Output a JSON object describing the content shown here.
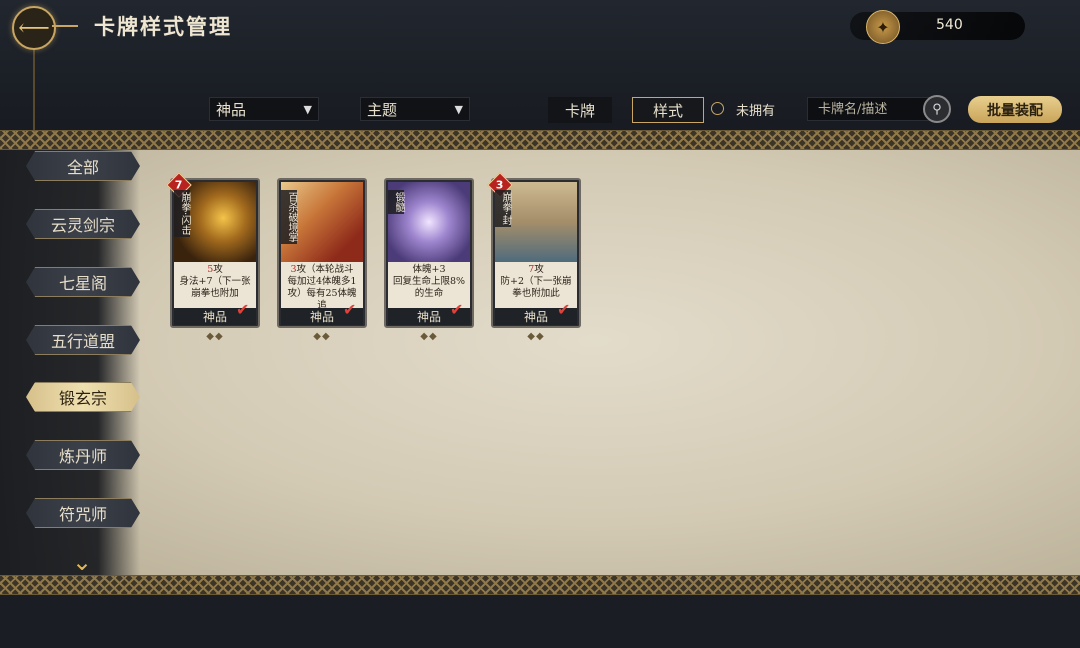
{
  "header": {
    "back_icon": "back-arrow-icon",
    "title": "卡牌样式管理",
    "currency": {
      "icon": "coin-icon",
      "value": "540"
    }
  },
  "filters": {
    "rarity": "神品",
    "theme": "主题",
    "tabs": {
      "cards": "卡牌",
      "style": "样式"
    },
    "unowned_label": "未拥有",
    "search_placeholder": "卡牌名/描述",
    "batch_label": "批量装配"
  },
  "sidebar": {
    "items": [
      {
        "label": "全部"
      },
      {
        "label": "云灵剑宗"
      },
      {
        "label": "七星阁"
      },
      {
        "label": "五行道盟"
      },
      {
        "label": "锻玄宗",
        "active": true
      },
      {
        "label": "炼丹师"
      },
      {
        "label": "符咒师"
      }
    ]
  },
  "cards": [
    {
      "cost": "7",
      "name": "崩拳·闪击",
      "desc_value": "5",
      "desc_main": "攻",
      "desc_rest": "身法+7（下一张崩拳也附加",
      "rank": "神品",
      "diamonds": "◆◆"
    },
    {
      "cost": "",
      "name": "百杀破境掌",
      "desc_value": "3",
      "desc_main": "攻（本轮战斗",
      "desc_rest": "每加过4体魄多1攻）每有25体魄追",
      "rank": "神品",
      "diamonds": "◆◆"
    },
    {
      "cost": "",
      "name": "锻髓",
      "desc_value": "",
      "desc_main": "体魄+3",
      "desc_rest": "回复生命上限8%的生命",
      "rank": "神品",
      "diamonds": "◆◆"
    },
    {
      "cost": "3",
      "name": "崩拳·封",
      "desc_value": "7",
      "desc_main": "攻",
      "desc_rest": "防+2（下一张崩拳也附加此",
      "rank": "神品",
      "diamonds": "◆◆"
    }
  ]
}
